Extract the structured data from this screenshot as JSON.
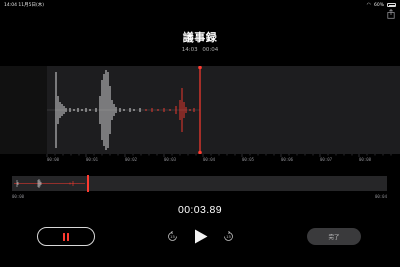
{
  "status": {
    "time": "14:04",
    "date": "11月5日(木)",
    "battery": "60%",
    "wifi_icon": "wifi-icon",
    "battery_icon": "battery-icon"
  },
  "recording": {
    "title": "議事録",
    "start_time": "14:03",
    "duration": "00:04"
  },
  "ruler": {
    "labels": [
      "00:00",
      "00:01",
      "00:02",
      "00:03",
      "00:04",
      "00:05",
      "00:06",
      "00:07",
      "00:08"
    ]
  },
  "overview": {
    "start_label": "00:00",
    "end_label": "00:04",
    "playhead_fraction": 0.2
  },
  "playback": {
    "current_time": "00:03.89",
    "skip_back_icon": "skip-back-15-icon",
    "play_icon": "play-icon",
    "skip_forward_icon": "skip-forward-15-icon",
    "pause_icon": "pause-icon",
    "done_label": "完了"
  },
  "colors": {
    "accent_red": "#ff3b30",
    "waveform_white": "#d8d8d8",
    "background": "#000000",
    "panel": "#1d1d1f"
  }
}
